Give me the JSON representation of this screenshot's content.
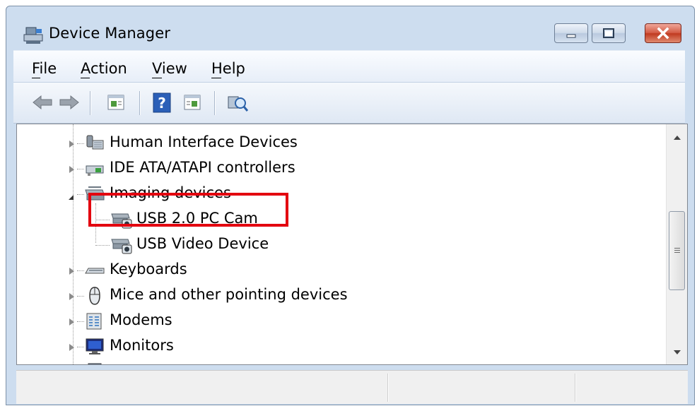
{
  "window": {
    "title": "Device Manager",
    "icons": {
      "app": "device-manager-icon",
      "minimize": "minimize-icon",
      "maximize": "maximize-icon",
      "close": "close-icon"
    }
  },
  "menu": {
    "items": [
      {
        "label": "File",
        "accel": "F"
      },
      {
        "label": "Action",
        "accel": "A"
      },
      {
        "label": "View",
        "accel": "V"
      },
      {
        "label": "Help",
        "accel": "H"
      }
    ]
  },
  "toolbar": {
    "buttons": [
      "back-arrow-icon",
      "forward-arrow-icon",
      "properties-icon",
      "help-icon",
      "show-hide-console-tree-icon",
      "scan-hardware-changes-icon"
    ]
  },
  "tree": {
    "items": [
      {
        "label": "Human Interface Devices",
        "icon": "hid-icon",
        "state": "collapsed"
      },
      {
        "label": "IDE ATA/ATAPI controllers",
        "icon": "ide-controller-icon",
        "state": "collapsed"
      },
      {
        "label": "Imaging devices",
        "icon": "imaging-device-icon",
        "state": "expanded"
      },
      {
        "label": "USB 2.0 PC Cam",
        "icon": "camera-icon",
        "state": "child"
      },
      {
        "label": "USB Video Device",
        "icon": "camera-icon",
        "state": "child"
      },
      {
        "label": "Keyboards",
        "icon": "keyboard-icon",
        "state": "collapsed"
      },
      {
        "label": "Mice and other pointing devices",
        "icon": "mouse-icon",
        "state": "collapsed"
      },
      {
        "label": "Modems",
        "icon": "modem-icon",
        "state": "collapsed"
      },
      {
        "label": "Monitors",
        "icon": "monitor-icon",
        "state": "collapsed"
      }
    ]
  },
  "annotation": {
    "color": "#e3000f",
    "target": "USB 2.0 PC Cam"
  },
  "colors": {
    "window_frame": "#cdddef",
    "close_button": "#c03a20",
    "content_bg": "#ffffff"
  }
}
